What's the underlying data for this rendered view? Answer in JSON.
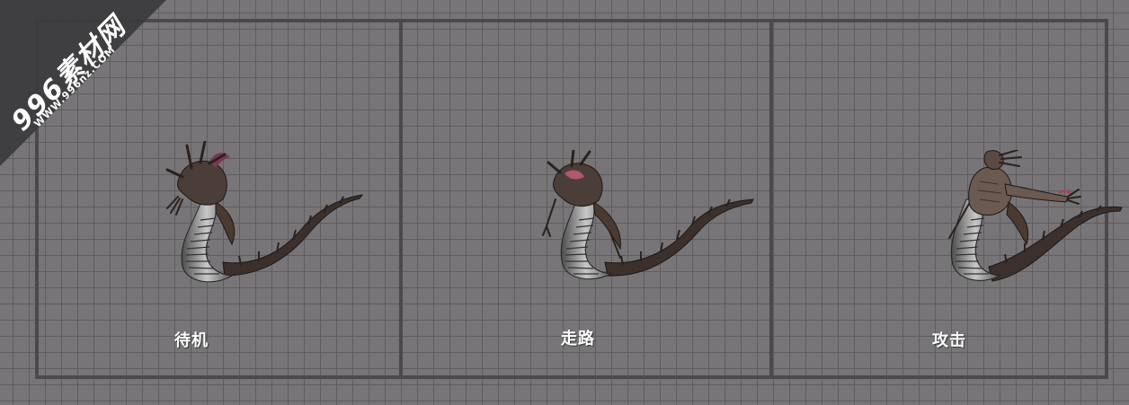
{
  "watermark": {
    "brand": "996素材网",
    "url": "WWW.996nz.COM"
  },
  "panels": [
    {
      "label": "待机"
    },
    {
      "label": "走路"
    },
    {
      "label": "攻击"
    }
  ],
  "colors": {
    "background": "#777578",
    "grid_line": "#5f5d60",
    "frame": "#4a494b",
    "label": "#ffffff",
    "watermark_bg": "#3c3b3d"
  },
  "icons": [
    "serpent-sprite-idle",
    "serpent-sprite-walk",
    "serpent-sprite-attack"
  ]
}
